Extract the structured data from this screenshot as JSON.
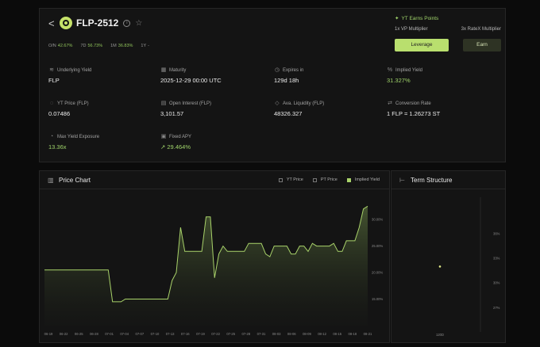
{
  "header": {
    "back_glyph": "<",
    "title": "FLP-2512",
    "info_glyph": "i",
    "star_glyph": "☆"
  },
  "performance": [
    {
      "label": "O/N",
      "value": "42.67%"
    },
    {
      "label": "7D",
      "value": "56.73%"
    },
    {
      "label": "1M",
      "value": "36.83%"
    },
    {
      "label": "1Y",
      "value": "-"
    }
  ],
  "earn_points": {
    "title": "YT Earns Points",
    "vp_multiplier": "1x VP Multiplier",
    "ratex_multiplier": "3x RateX Multiplier",
    "leverage_label": "Leverage",
    "earn_label": "Earn"
  },
  "stats": [
    {
      "label": "Underlying Yield",
      "value": "FLP",
      "icon": "layers-icon",
      "highlight": false
    },
    {
      "label": "Maturity",
      "value": "2025-12-29 00:00 UTC",
      "icon": "calendar-icon",
      "highlight": false
    },
    {
      "label": "Expires in",
      "value": "129d 18h",
      "icon": "clock-icon",
      "highlight": false
    },
    {
      "label": "Implied Yield",
      "value": "31.327%",
      "icon": "percent-icon",
      "highlight": true
    },
    {
      "label": "YT Price (FLP)",
      "value": "0.07486",
      "icon": "tag-icon",
      "highlight": false
    },
    {
      "label": "Open Interest (FLP)",
      "value": "3,101.57",
      "icon": "chart-icon",
      "highlight": false
    },
    {
      "label": "Ava. Liquidity (FLP)",
      "value": "48326.327",
      "icon": "drop-icon",
      "highlight": false
    },
    {
      "label": "Conversion Rate",
      "value": "1 FLP = 1.26273 ST",
      "icon": "swap-icon",
      "highlight": false
    },
    {
      "label": "Max Yield Exposure",
      "value": "13.36x",
      "icon": "gauge-icon",
      "highlight": true
    },
    {
      "label": "Fixed APY",
      "value": "29.464%",
      "icon": "lock-icon",
      "highlight": true,
      "trend_glyph": "↗"
    }
  ],
  "price_chart": {
    "title": "Price Chart",
    "legend": [
      {
        "label": "YT Price",
        "checked": false
      },
      {
        "label": "PT Price",
        "checked": false
      },
      {
        "label": "Implied Yield",
        "checked": true
      }
    ]
  },
  "term_structure": {
    "title": "Term Structure"
  },
  "colors": {
    "accent": "#a9d36a",
    "accent_text": "#9fd36a",
    "card_bg": "#141414"
  },
  "chart_data": [
    {
      "type": "area",
      "series": [
        {
          "name": "Implied Yield",
          "values": [
            20.5,
            20.5,
            20.5,
            20.5,
            20.5,
            20.5,
            20.5,
            20.5,
            20.5,
            20.5,
            20.5,
            20.5,
            20.5,
            20.5,
            20.5,
            20.5,
            14.5,
            14.5,
            14.5,
            15.0,
            15.0,
            15.0,
            15.0,
            15.0,
            15.0,
            15.0,
            15.0,
            15.0,
            15.0,
            15.0,
            18.5,
            20.0,
            28.5,
            24.0,
            24.0,
            24.0,
            24.0,
            24.0,
            30.5,
            30.5,
            19.0,
            23.5,
            25.0,
            24.0,
            24.0,
            24.0,
            24.0,
            24.0,
            25.5,
            25.5,
            25.5,
            25.5,
            23.5,
            23.0,
            25.0,
            25.0,
            25.0,
            25.0,
            23.5,
            23.5,
            25.0,
            25.0,
            24.0,
            25.5,
            25.0,
            25.0,
            25.0,
            25.0,
            25.5,
            24.0,
            24.0,
            26.0,
            26.0,
            26.0,
            28.5,
            32.0,
            32.5
          ]
        }
      ],
      "x": [
        "06-19",
        "06-22",
        "06-25",
        "06-28",
        "07-01",
        "07-04",
        "07-07",
        "07-10",
        "07-13",
        "07-16",
        "07-19",
        "07-22",
        "07-25",
        "07-28",
        "07-31",
        "08-03",
        "08-06",
        "08-09",
        "08-12",
        "08-15",
        "08-18",
        "08-21"
      ],
      "y_ticks": [
        "15.00%",
        "20.00%",
        "25.00%",
        "30.00%"
      ],
      "ylim": [
        10,
        33
      ],
      "grid": false
    },
    {
      "type": "scatter",
      "points": [
        {
          "x": "120D",
          "y": 32.0
        }
      ],
      "x": [
        "120D"
      ],
      "y_ticks": [
        "27%",
        "30%",
        "33%",
        "36%"
      ],
      "ylim": [
        25.5,
        38
      ]
    }
  ]
}
